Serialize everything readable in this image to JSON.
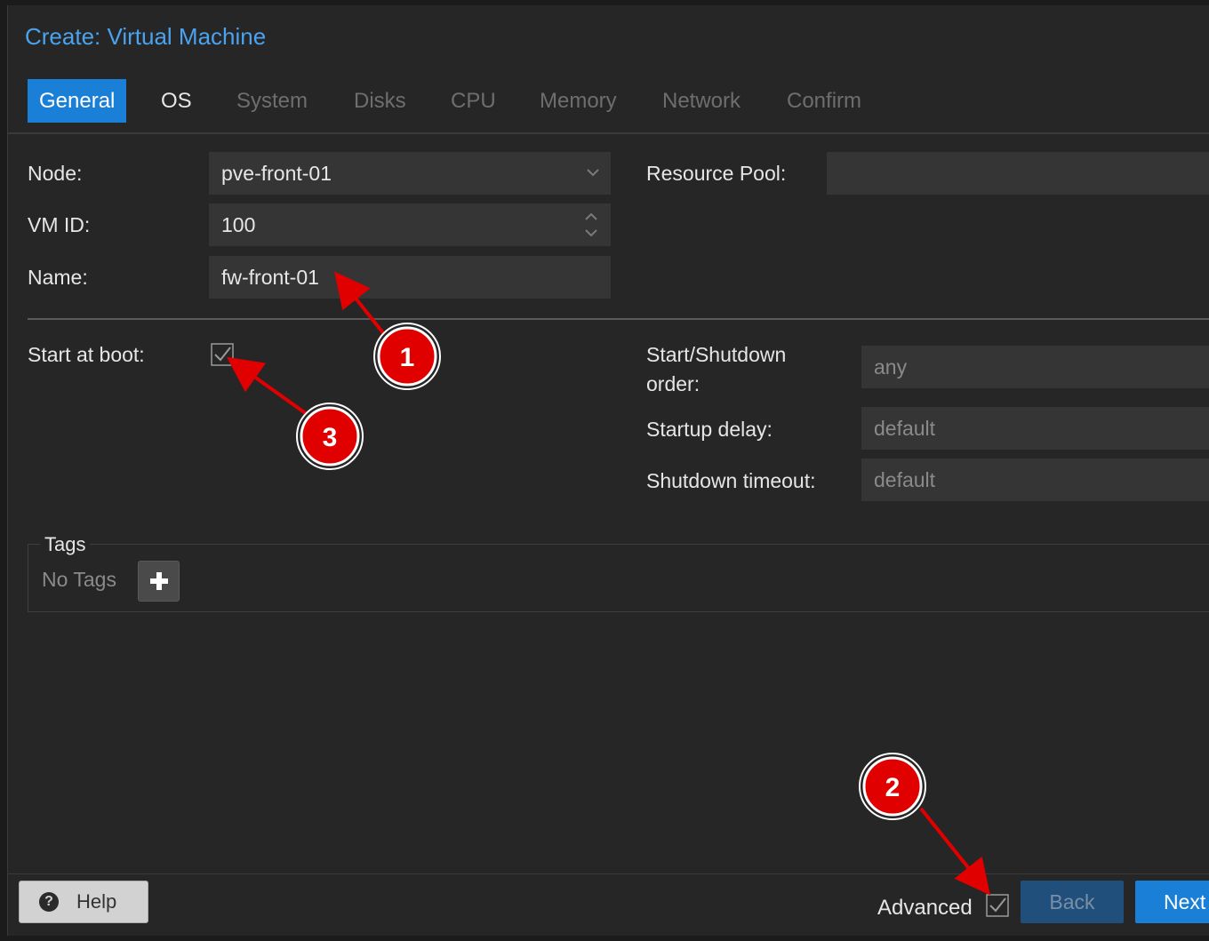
{
  "window": {
    "title": "Create: Virtual Machine"
  },
  "tabs": [
    {
      "label": "General",
      "state": "active"
    },
    {
      "label": "OS",
      "state": "enabled"
    },
    {
      "label": "System",
      "state": "disabled"
    },
    {
      "label": "Disks",
      "state": "disabled"
    },
    {
      "label": "CPU",
      "state": "disabled"
    },
    {
      "label": "Memory",
      "state": "disabled"
    },
    {
      "label": "Network",
      "state": "disabled"
    },
    {
      "label": "Confirm",
      "state": "disabled"
    }
  ],
  "form": {
    "node": {
      "label": "Node:",
      "value": "pve-front-01"
    },
    "vmid": {
      "label": "VM ID:",
      "value": "100"
    },
    "name": {
      "label": "Name:",
      "value": "fw-front-01"
    },
    "resource_pool": {
      "label": "Resource Pool:",
      "value": ""
    },
    "start_at_boot": {
      "label": "Start at boot:",
      "checked": true
    },
    "start_shutdown_order": {
      "label_line1": "Start/Shutdown",
      "label_line2": "order:",
      "placeholder": "any"
    },
    "startup_delay": {
      "label": "Startup delay:",
      "placeholder": "default"
    },
    "shutdown_timeout": {
      "label": "Shutdown timeout:",
      "placeholder": "default"
    }
  },
  "tags": {
    "legend": "Tags",
    "empty_text": "No Tags"
  },
  "footer": {
    "help_label": "Help",
    "advanced_label": "Advanced",
    "advanced_checked": true,
    "back_label": "Back",
    "next_label": "Next"
  },
  "annotations": [
    {
      "number": "1"
    },
    {
      "number": "2"
    },
    {
      "number": "3"
    }
  ],
  "colors": {
    "accent": "#1a7fd6",
    "title": "#4aa3ee",
    "annotation_red": "#e00000",
    "background": "#262626"
  }
}
